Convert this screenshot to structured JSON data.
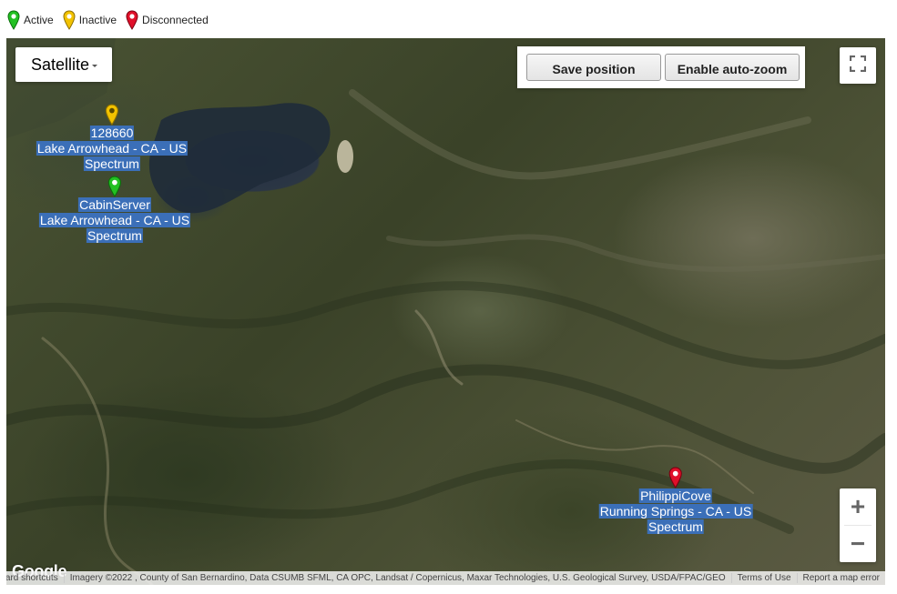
{
  "legend": {
    "items": [
      {
        "label": "Active",
        "color": "#22c022"
      },
      {
        "label": "Inactive",
        "color": "#e6b800"
      },
      {
        "label": "Disconnected",
        "color": "#e0102a"
      }
    ]
  },
  "map": {
    "type_label": "Satellite",
    "buttons": {
      "save_position": "Save position",
      "enable_auto_zoom": "Enable auto-zoom"
    },
    "zoom_in": "+",
    "zoom_out": "−",
    "markers": [
      {
        "status": "Inactive",
        "color": "#e6b800",
        "lines": [
          "128660",
          "Lake Arrowhead - CA - US",
          "Spectrum"
        ]
      },
      {
        "status": "Active",
        "color": "#22c022",
        "lines": [
          "CabinServer",
          "Lake Arrowhead - CA - US",
          "Spectrum"
        ]
      },
      {
        "status": "Disconnected",
        "color": "#e0102a",
        "lines": [
          "PhilippiCove",
          "Running Springs - CA - US",
          "Spectrum"
        ]
      }
    ],
    "footer": {
      "logo": "Google",
      "keyboard_shortcuts": "Keyboard shortcuts",
      "imagery": "Imagery ©2022 , County of San Bernardino, Data CSUMB SFML, CA OPC, Landsat / Copernicus, Maxar Technologies, U.S. Geological Survey, USDA/FPAC/GEO",
      "terms": "Terms of Use",
      "report": "Report a map error"
    }
  }
}
